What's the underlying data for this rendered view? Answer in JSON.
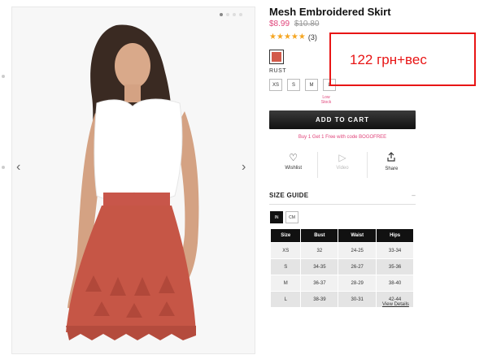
{
  "product": {
    "title": "Mesh Embroidered Skirt",
    "price_sale": "$8.99",
    "price_original": "$10.80",
    "rating_stars": 5,
    "review_count": "(3)",
    "color_name": "RUST",
    "swatch_color": "#d25a4a",
    "sizes": [
      "XS",
      "S",
      "M",
      "L"
    ],
    "low_stock_label": "Low Stock"
  },
  "cart": {
    "add_label": "ADD TO CART",
    "promo_text": "Buy 1 Get 1 Free with code BOGOFREE"
  },
  "actions": {
    "wishlist": "Wishlist",
    "video": "Video",
    "share": "Share"
  },
  "size_guide": {
    "title": "SIZE GUIDE",
    "toggle": "–",
    "units": [
      "IN",
      "CM"
    ],
    "active_unit": "IN",
    "headers": [
      "Size",
      "Bust",
      "Waist",
      "Hips"
    ],
    "rows": [
      [
        "XS",
        "32",
        "24-25",
        "33-34"
      ],
      [
        "S",
        "34-35",
        "26-27",
        "35-36"
      ],
      [
        "M",
        "36-37",
        "28-29",
        "38-40"
      ],
      [
        "L",
        "38-39",
        "30-31",
        "42-44"
      ]
    ],
    "view_details": "View Details"
  },
  "annotation": {
    "text": "122 грн+вес",
    "color": "#e81515"
  },
  "colors": {
    "accent": "#e0457b",
    "star": "#f5a623",
    "cart_bg": "#111111"
  },
  "icons": {
    "prev": "chevron-left-icon",
    "next": "chevron-right-icon",
    "wishlist": "heart-icon",
    "video": "play-icon",
    "share": "share-icon"
  }
}
